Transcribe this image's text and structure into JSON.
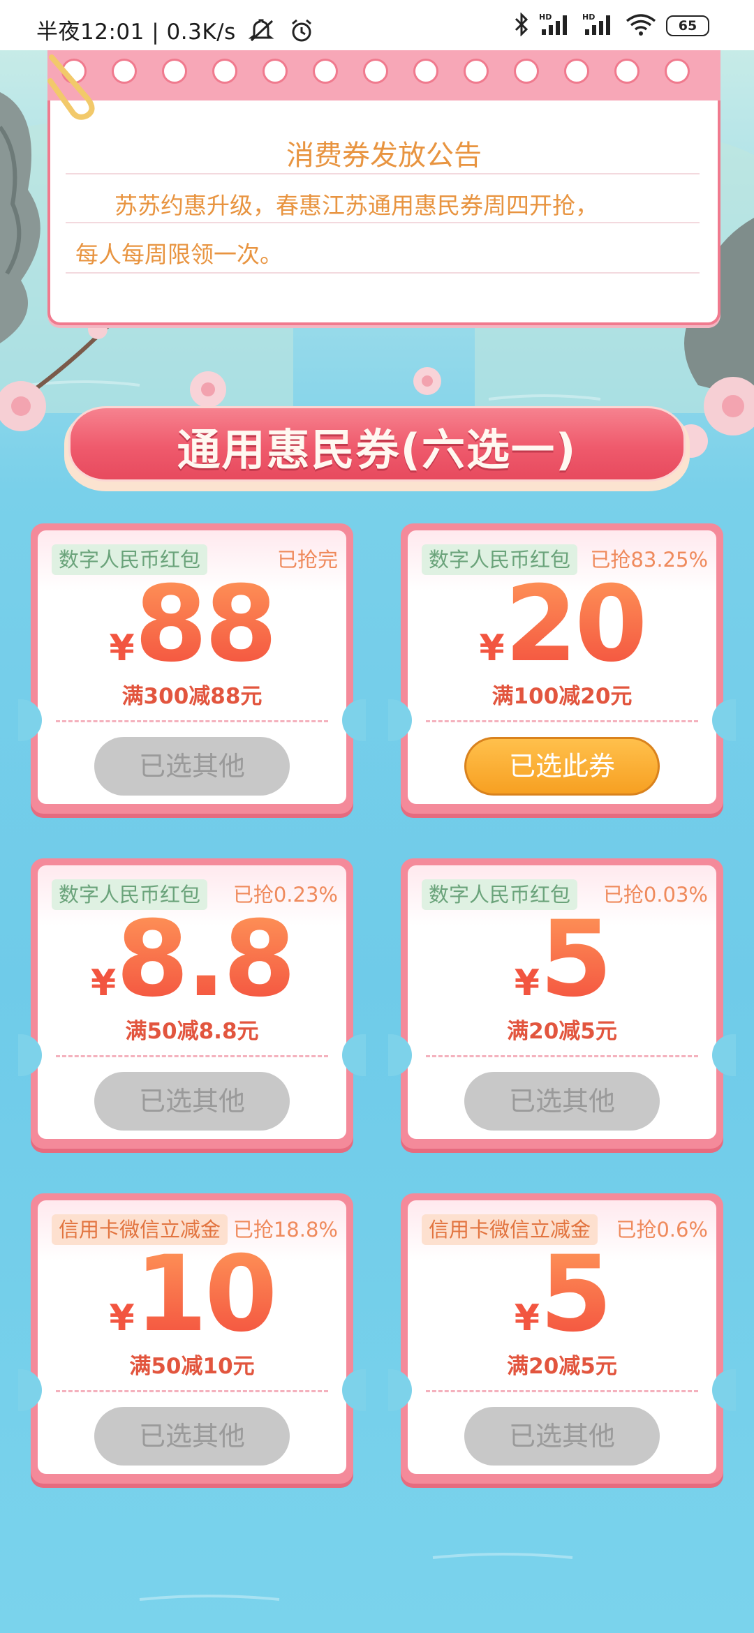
{
  "status_bar": {
    "time": "半夜12:01",
    "speed": "0.3K/s",
    "battery": "65",
    "icons": [
      "mute-icon",
      "alarm-icon",
      "bluetooth-icon",
      "signal-hd-icon",
      "signal-hd-icon",
      "wifi-icon",
      "battery-icon"
    ]
  },
  "notice": {
    "title": "消费券发放公告",
    "line1": "苏苏约惠升级，春惠江苏通用惠民券周四开抢，",
    "line2": "每人每周限领一次。"
  },
  "section": {
    "title": "通用惠民券(六选一)"
  },
  "coupons": [
    {
      "tag": "数字人民币红包",
      "tag_style": "green",
      "progress": "已抢完",
      "currency": "¥",
      "amount": "88",
      "desc": "满300减88元",
      "button": "已选其他",
      "button_style": "grey"
    },
    {
      "tag": "数字人民币红包",
      "tag_style": "green",
      "progress": "已抢83.25%",
      "currency": "¥",
      "amount": "20",
      "desc": "满100减20元",
      "button": "已选此券",
      "button_style": "orange"
    },
    {
      "tag": "数字人民币红包",
      "tag_style": "green",
      "progress": "已抢0.23%",
      "currency": "¥",
      "amount": "8.8",
      "desc": "满50减8.8元",
      "button": "已选其他",
      "button_style": "grey"
    },
    {
      "tag": "数字人民币红包",
      "tag_style": "green",
      "progress": "已抢0.03%",
      "currency": "¥",
      "amount": "5",
      "desc": "满20减5元",
      "button": "已选其他",
      "button_style": "grey"
    },
    {
      "tag": "信用卡微信立减金",
      "tag_style": "orange",
      "progress": "已抢18.8%",
      "currency": "¥",
      "amount": "10",
      "desc": "满50减10元",
      "button": "已选其他",
      "button_style": "grey"
    },
    {
      "tag": "信用卡微信立减金",
      "tag_style": "orange",
      "progress": "已抢0.6%",
      "currency": "¥",
      "amount": "5",
      "desc": "满20减5元",
      "button": "已选其他",
      "button_style": "grey"
    }
  ],
  "colors": {
    "accent_pink": "#f07a8e",
    "notice_text": "#e89440",
    "amount_red": "#f25540",
    "selected_button": "#f7a022",
    "disabled_button": "#c8c8c8",
    "water": "#6fcbe9"
  }
}
